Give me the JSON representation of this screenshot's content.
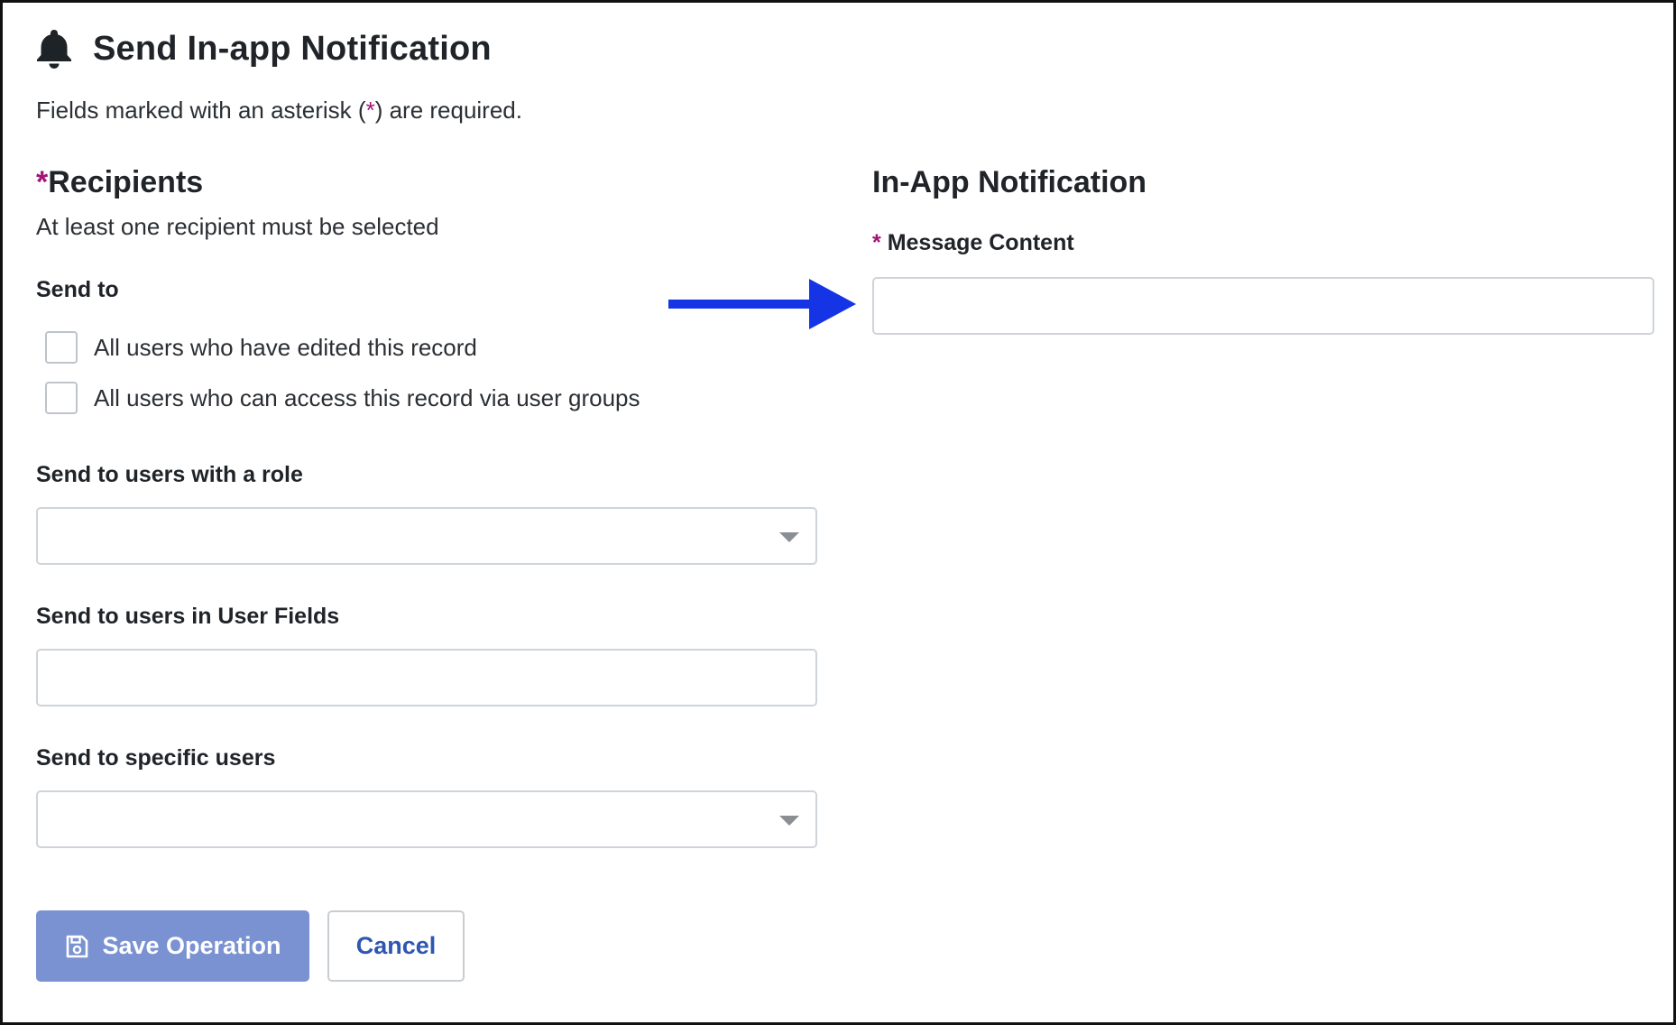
{
  "header": {
    "icon": "bell-icon",
    "title": "Send In-app Notification"
  },
  "required_note": {
    "before": "Fields marked with an asterisk (",
    "asterisk": "*",
    "after": ") are required."
  },
  "recipients": {
    "asterisk": "*",
    "title": "Recipients",
    "subtitle": "At least one recipient must be selected",
    "send_to_label": "Send to",
    "checkboxes": [
      {
        "label": "All users who have edited this record",
        "checked": false
      },
      {
        "label": "All users who can access this record via user groups",
        "checked": false
      }
    ],
    "role_label": "Send to users with a role",
    "role_value": "",
    "user_fields_label": "Send to users in User Fields",
    "user_fields_value": "",
    "specific_users_label": "Send to specific users",
    "specific_users_value": ""
  },
  "notification": {
    "title": "In-App Notification",
    "message_asterisk": "*",
    "message_label": "Message Content",
    "message_value": ""
  },
  "buttons": {
    "save_label": "Save Operation",
    "save_icon": "floppy-disk-icon",
    "cancel_label": "Cancel"
  },
  "colors": {
    "asterisk": "#a01475",
    "save_button": "#7b92d2",
    "cancel_text": "#2f56b0",
    "arrow": "#1434e6"
  }
}
